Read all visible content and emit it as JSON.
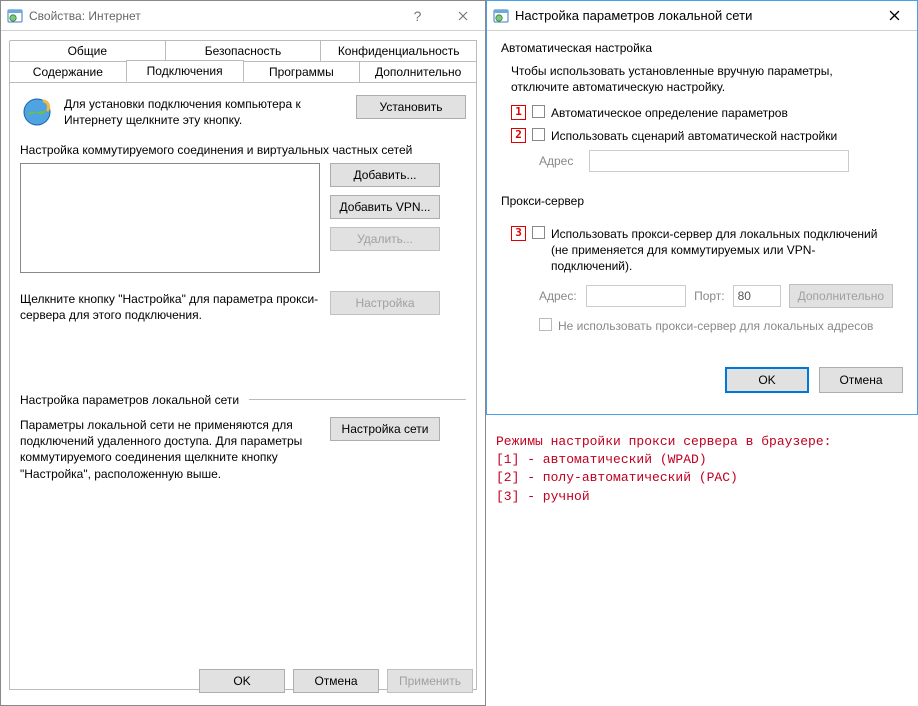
{
  "left": {
    "title": "Свойства: Интернет",
    "tabs_row1": [
      "Общие",
      "Безопасность",
      "Конфиденциальность"
    ],
    "tabs_row2": [
      "Содержание",
      "Подключения",
      "Программы",
      "Дополнительно"
    ],
    "active_tab": "Подключения",
    "install_text": "Для установки подключения компьютера к Интернету щелкните эту кнопку.",
    "install_btn": "Установить",
    "dialup_label": "Настройка коммутируемого соединения и виртуальных частных сетей",
    "btn_add": "Добавить...",
    "btn_add_vpn": "Добавить VPN...",
    "btn_delete": "Удалить...",
    "btn_settings": "Настройка",
    "settings_hint": "Щелкните кнопку \"Настройка\" для параметра прокси-сервера для этого подключения.",
    "lan_group": "Настройка параметров локальной сети",
    "lan_text": "Параметры локальной сети не применяются для подключений удаленного доступа. Для параметры коммутируемого соединения щелкните кнопку \"Настройка\", расположенную выше.",
    "lan_btn": "Настройка сети",
    "ok": "OK",
    "cancel": "Отмена",
    "apply": "Применить"
  },
  "right": {
    "title": "Настройка параметров локальной сети",
    "auto_group": "Автоматическая настройка",
    "auto_text": "Чтобы использовать установленные вручную параметры, отключите автоматическую настройку.",
    "chk_auto_detect": "Автоматическое определение параметров",
    "chk_auto_script": "Использовать сценарий автоматической настройки",
    "addr_label": "Адрес",
    "script_addr": "",
    "proxy_group": "Прокси-сервер",
    "chk_proxy": "Использовать прокси-сервер для локальных подключений (не применяется для коммутируемых или VPN-подключений).",
    "proxy_addr_label": "Адрес:",
    "proxy_addr": "",
    "proxy_port_label": "Порт:",
    "proxy_port": "80",
    "btn_advanced": "Дополнительно",
    "chk_bypass": "Не использовать прокси-сервер для локальных адресов",
    "ok": "OK",
    "cancel": "Отмена",
    "badges": {
      "1": "1",
      "2": "2",
      "3": "3"
    }
  },
  "notes": {
    "l1": "Режимы настройки прокси сервера в браузере:",
    "l2": "[1] - автоматический (WPAD)",
    "l3": "[2] - полу-автоматический (PAC)",
    "l4": "[3] - ручной"
  }
}
